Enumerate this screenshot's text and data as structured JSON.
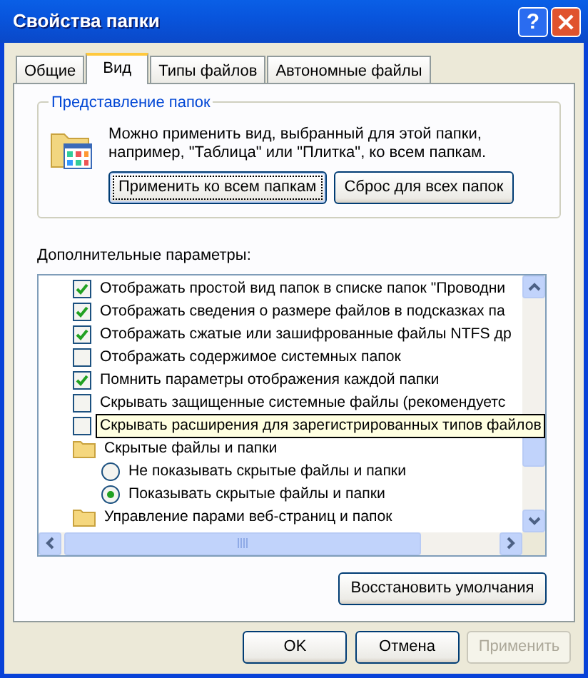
{
  "window": {
    "title": "Свойства папки",
    "help": "?"
  },
  "tabs": [
    {
      "label": "Общие",
      "selected": false
    },
    {
      "label": "Вид",
      "selected": true
    },
    {
      "label": "Типы файлов",
      "selected": false
    },
    {
      "label": "Автономные файлы",
      "selected": false
    }
  ],
  "folder_views": {
    "title": "Представление папок",
    "text": "Можно применить вид, выбранный для этой папки, например, \"Таблица\" или \"Плитка\", ко всем папкам.",
    "buttons": [
      {
        "label": "Применить ко всем папкам",
        "focused": true
      },
      {
        "label": "Сброс для всех папок",
        "focused": false
      }
    ]
  },
  "advanced": {
    "label": "Дополнительные параметры:",
    "items": [
      {
        "kind": "checkbox",
        "text": "Отображать простой вид папок в списке папок \"Проводни",
        "checked": true
      },
      {
        "kind": "checkbox",
        "text": "Отображать сведения о размере файлов в подсказках па",
        "checked": true
      },
      {
        "kind": "checkbox",
        "text": "Отображать сжатые или зашифрованные файлы NTFS др",
        "checked": true
      },
      {
        "kind": "checkbox",
        "text": "Отображать содержимое системных папок",
        "checked": false
      },
      {
        "kind": "checkbox",
        "text": "Помнить параметры отображения каждой папки",
        "checked": true
      },
      {
        "kind": "checkbox",
        "text": "Скрывать защищенные системные файлы (рекомендуетс",
        "checked": false
      },
      {
        "kind": "checkbox",
        "text": "Скрывать расширения для зарегистрированных типов файлов",
        "checked": false,
        "tooltip": true
      },
      {
        "kind": "folder",
        "text": "Скрытые файлы и папки",
        "children": [
          {
            "kind": "radio",
            "text": "Не показывать скрытые файлы и папки",
            "selected": false
          },
          {
            "kind": "radio",
            "text": "Показывать скрытые файлы и папки",
            "selected": true
          }
        ]
      },
      {
        "kind": "folder",
        "text": "Управление парами веб-страниц и папок"
      }
    ]
  },
  "restore_button": "Восстановить умолчания",
  "buttons": [
    {
      "label": "OK",
      "disabled": false
    },
    {
      "label": "Отмена",
      "disabled": false
    },
    {
      "label": "Применить",
      "disabled": true
    }
  ]
}
